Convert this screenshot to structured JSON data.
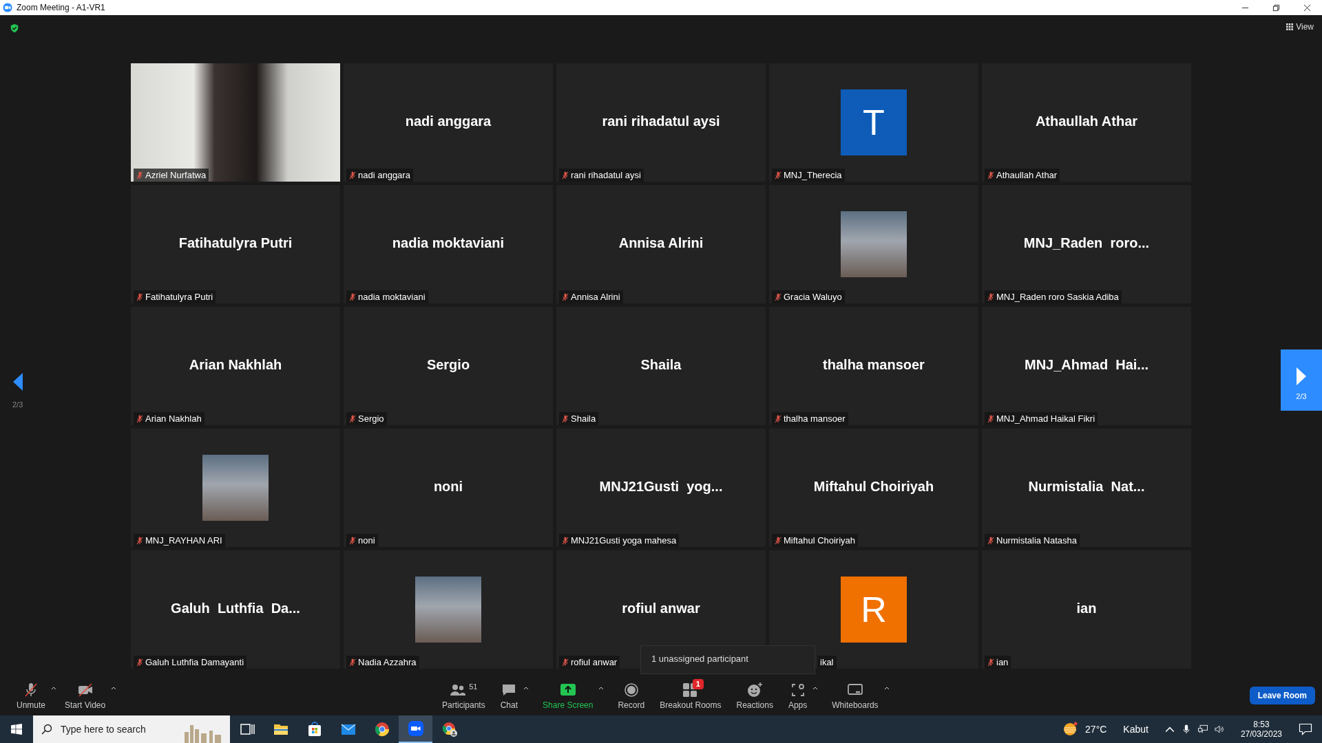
{
  "window": {
    "title": "Zoom Meeting - A1-VR1"
  },
  "top_bar": {
    "view_label": "View"
  },
  "pager": {
    "left_label": "2/3",
    "right_label": "2/3"
  },
  "tiles": [
    {
      "kind": "video",
      "label": "Azriel Nurfatwa",
      "muted": true
    },
    {
      "kind": "name",
      "name": "nadi anggara",
      "label": "nadi anggara",
      "muted": true
    },
    {
      "kind": "name",
      "name": "rani rihadatul aysi",
      "label": "rani rihadatul aysi",
      "muted": true
    },
    {
      "kind": "letter",
      "name": "T",
      "color": "#0e5cb8",
      "label": "MNJ_Therecia",
      "muted": true
    },
    {
      "kind": "name",
      "name": "Athaullah Athar",
      "label": "Athaullah Athar",
      "muted": true
    },
    {
      "kind": "name",
      "name": "Fatihatulyra Putri",
      "label": "Fatihatulyra Putri",
      "muted": true
    },
    {
      "kind": "name",
      "name": "nadia moktaviani",
      "label": "nadia moktaviani",
      "muted": true
    },
    {
      "kind": "name",
      "name": "Annisa Alrini",
      "label": "Annisa Alrini",
      "muted": true
    },
    {
      "kind": "picture",
      "label": "Gracia Waluyo",
      "muted": true
    },
    {
      "kind": "name",
      "name": "MNJ_Raden  roro...",
      "label": "MNJ_Raden roro Saskia Adiba",
      "muted": true
    },
    {
      "kind": "name",
      "name": "Arian Nakhlah",
      "label": "Arian Nakhlah",
      "muted": true
    },
    {
      "kind": "name",
      "name": "Sergio",
      "label": "Sergio",
      "muted": true
    },
    {
      "kind": "name",
      "name": "Shaila",
      "label": "Shaila",
      "muted": true
    },
    {
      "kind": "name",
      "name": "thalha mansoer",
      "label": "thalha mansoer",
      "muted": true
    },
    {
      "kind": "name",
      "name": "MNJ_Ahmad  Hai...",
      "label": "MNJ_Ahmad Haikal Fikri",
      "muted": true
    },
    {
      "kind": "picture",
      "label": "MNJ_RAYHAN ARI",
      "muted": true
    },
    {
      "kind": "name",
      "name": "noni",
      "label": "noni",
      "muted": true
    },
    {
      "kind": "name",
      "name": "MNJ21Gusti  yog...",
      "label": "MNJ21Gusti yoga mahesa",
      "muted": true
    },
    {
      "kind": "name",
      "name": "Miftahul Choiriyah",
      "label": "Miftahul Choiriyah",
      "muted": true
    },
    {
      "kind": "name",
      "name": "Nurmistalia  Nat...",
      "label": "Nurmistalia Natasha",
      "muted": true
    },
    {
      "kind": "name",
      "name": "Galuh  Luthfia  Da...",
      "label": "Galuh Luthfia Damayanti",
      "muted": true
    },
    {
      "kind": "picture",
      "label": "Nadia Azzahra",
      "muted": true
    },
    {
      "kind": "name",
      "name": "rofiul anwar",
      "label": "rofiul anwar",
      "muted": true
    },
    {
      "kind": "letter",
      "name": "R",
      "color": "#f07000",
      "label": "ikal"
    },
    {
      "kind": "name",
      "name": "ian",
      "label": "ian",
      "muted": true
    }
  ],
  "tooltip": "1 unassigned participant",
  "toolbar": {
    "left": [
      {
        "kind": "mic",
        "label": "Unmute",
        "caret": true
      },
      {
        "kind": "camera",
        "label": "Start Video",
        "caret": true
      }
    ],
    "center": [
      {
        "kind": "participants",
        "label": "Participants",
        "count": "51",
        "caret": false
      },
      {
        "kind": "chat",
        "label": "Chat",
        "caret": true
      },
      {
        "kind": "share",
        "label": "Share Screen",
        "caret": true
      },
      {
        "kind": "record",
        "label": "Record",
        "caret": false
      },
      {
        "kind": "breakout",
        "label": "Breakout Rooms",
        "badge": "1",
        "caret": false
      },
      {
        "kind": "reactions",
        "label": "Reactions",
        "caret": false
      },
      {
        "kind": "apps",
        "label": "Apps",
        "caret": true
      },
      {
        "kind": "whiteboards",
        "label": "Whiteboards",
        "caret": true
      }
    ],
    "leave_label": "Leave Room"
  },
  "taskbar": {
    "search_placeholder": "Type here to search",
    "apps": [
      {
        "kind": "taskview",
        "selected": false
      },
      {
        "kind": "folder",
        "selected": false
      },
      {
        "kind": "store",
        "selected": false
      },
      {
        "kind": "mail",
        "selected": false
      },
      {
        "kind": "chrome",
        "selected": false
      },
      {
        "kind": "zoom",
        "selected": true
      },
      {
        "kind": "chrome-profile",
        "selected": false
      }
    ],
    "temperature": "27°C",
    "weather": "Kabut",
    "time": "8:53",
    "date": "27/03/2023"
  }
}
